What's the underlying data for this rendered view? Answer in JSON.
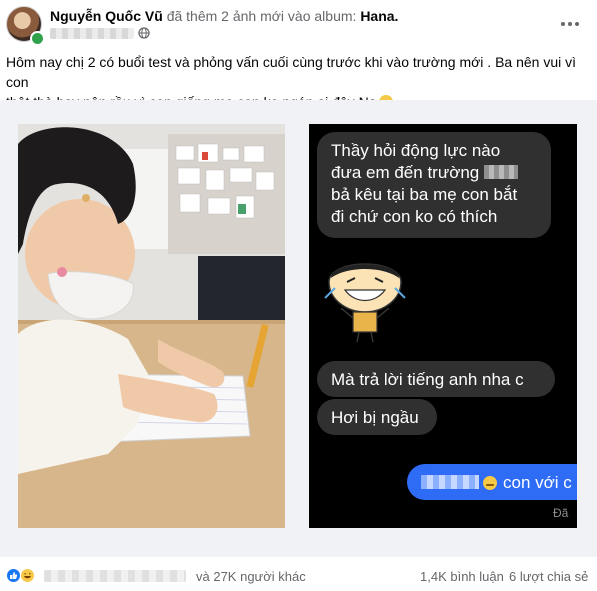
{
  "post": {
    "author_name": "Nguyễn Quốc Vũ",
    "action_text": "đã thêm 2 ảnh mới vào album:",
    "album_name": "Hana.",
    "caption_line1": "Hôm nay chị 2 có buổi test và phỏng vấn cuối cùng trước khi vào trường mới . Ba nên vui vì con",
    "caption_line2": "thật thà hay nên rầu vì con giống mẹ con ko ngán ai đây Na"
  },
  "chat": {
    "msg1_line1": "Thầy hỏi động lực nào",
    "msg1_line2": "đưa em đến trường",
    "msg1_line3": "bả kêu tại ba mẹ con bắt",
    "msg1_line4": "đi chứ con ko có thích",
    "msg2": "Mà trả lời tiếng anh nha c",
    "msg3": "Hơi bị ngầu",
    "msg_sent": "con với c",
    "seen_label": "Đã"
  },
  "footer": {
    "others_text": "và 27K người khác",
    "comments": "1,4K bình luận",
    "shares": "6 lượt chia sẻ"
  },
  "icons": [
    "globe-icon",
    "more-options-icon",
    "like-reaction-icon",
    "haha-reaction-icon",
    "sticker-icon"
  ],
  "colors": {
    "like": "#1877f2",
    "sent_bubble": "#2f6cf6",
    "received_bubble": "#303030"
  }
}
